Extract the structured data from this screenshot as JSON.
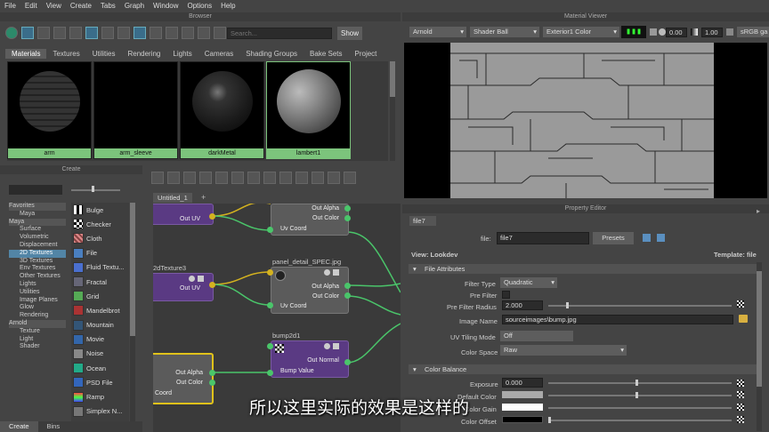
{
  "menu": [
    "File",
    "Edit",
    "View",
    "Create",
    "Tabs",
    "Graph",
    "Window",
    "Options",
    "Help"
  ],
  "browser": {
    "title": "Browser",
    "search_placeholder": "Search...",
    "show_label": "Show",
    "tabs": [
      "Materials",
      "Textures",
      "Utilities",
      "Rendering",
      "Lights",
      "Cameras",
      "Shading Groups",
      "Bake Sets",
      "Project"
    ],
    "materials": [
      "arm",
      "arm_sleeve",
      "darkMetal",
      "lambert1"
    ]
  },
  "create": {
    "title": "Create",
    "tree": [
      "Favorites",
      "Maya",
      "Maya",
      "Surface",
      "Volumetric",
      "Displacement",
      "2D Textures",
      "3D Textures",
      "Env Textures",
      "Other Textures",
      "Lights",
      "Utilities",
      "Image Planes",
      "Glow",
      "Rendering",
      "Arnold",
      "Texture",
      "Light",
      "Shader"
    ],
    "textures": [
      "Bulge",
      "Checker",
      "Cloth",
      "File",
      "Fluid Textu...",
      "Fractal",
      "Grid",
      "Mandelbrot",
      "Mountain",
      "Movie",
      "Noise",
      "Ocean",
      "PSD File",
      "Ramp",
      "Simplex N..."
    ],
    "bottom_tabs": [
      "Create",
      "Bins"
    ]
  },
  "graph": {
    "tab": "Untitled_1",
    "add_tab": "+",
    "nodes": {
      "n1_out_uv": "Out UV",
      "n2_out_alpha": "Out Alpha",
      "n2_out_color": "Out Color",
      "n2_uv": "Uv Coord",
      "n3_title": "2dTexture3",
      "n3_out_uv": "Out UV",
      "n4_title": "panel_detail_SPEC.jpg",
      "n4_out_alpha": "Out Alpha",
      "n4_out_color": "Out Color",
      "n4_uv": "Uv Coord",
      "n5_title": "bump2d1",
      "n5_out_normal": "Out Normal",
      "n5_bump": "Bump Value",
      "n6_out_alpha": "Out Alpha",
      "n6_out_color": "Out Color",
      "n6_coord": "Coord"
    }
  },
  "viewer": {
    "title": "Material Viewer",
    "renderer": "Arnold",
    "geometry": "Shader Ball",
    "env": "Exterior1 Color",
    "exposure": "0.00",
    "gamma": "1.00",
    "colorspace": "sRGB ga"
  },
  "property": {
    "title": "Property Editor",
    "node_tab": "file7",
    "file_label": "file:",
    "file_value": "file7",
    "presets": "Presets",
    "view": "View: Lookdev",
    "template": "Template: file",
    "section_file": "File Attributes",
    "section_color": "Color Balance",
    "filter_type_label": "Filter Type",
    "filter_type_value": "Quadratic",
    "pre_filter_label": "Pre Filter",
    "pre_filter_radius_label": "Pre Filter Radius",
    "pre_filter_radius_value": "2.000",
    "image_name_label": "Image Name",
    "image_name_value": "sourceimages\\bump.jpg",
    "uv_tiling_label": "UV Tiling Mode",
    "uv_tiling_value": "Off",
    "color_space_label": "Color Space",
    "color_space_value": "Raw",
    "exposure_label": "Exposure",
    "exposure_value": "0.000",
    "default_color_label": "Default Color",
    "color_gain_label": "Color Gain",
    "color_offset_label": "Color Offset"
  },
  "subtitle": "所以这里实际的效果是这样的"
}
